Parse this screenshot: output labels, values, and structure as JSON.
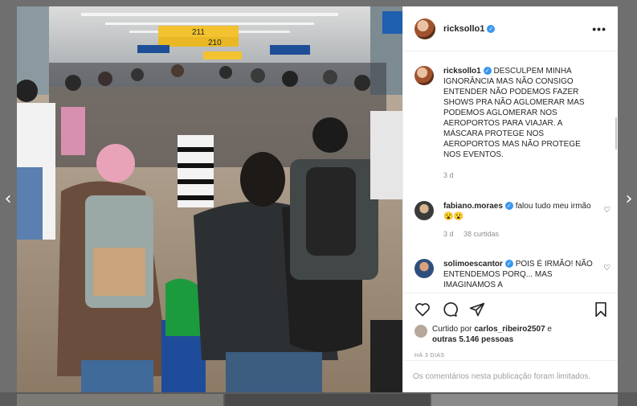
{
  "post": {
    "author": "ricksollo1",
    "more_label": "•••",
    "caption": "DESCULPEM MINHA IGNORÂNCIA MAS NÃO CONSIGO ENTENDER NÃO PODEMOS FAZER SHOWS PRA NÃO AGLOMERAR MAS PODEMOS AGLOMERAR NOS AEROPORTOS PARA VIAJAR. A MÁSCARA PROTEGE NOS AEROPORTOS MAS NÃO PROTEGE NOS EVENTOS.",
    "caption_time": "3 d"
  },
  "photo": {
    "signs": [
      "211",
      "210"
    ]
  },
  "comments": [
    {
      "user": "fabiano.moraes",
      "text": "falou tudo meu irmão 😮😮",
      "time": "3 d",
      "likes": "38 curtidas"
    },
    {
      "user": "solimoescantor",
      "text": "POIS É IRMÃO! NÃO ENTENDEMOS PORQ... MAS IMAGINAMOS A",
      "time": "",
      "likes": ""
    }
  ],
  "likes": {
    "prefix": "Curtido por",
    "user": "carlos_ribeiro2507",
    "mid": "e",
    "others": "outras 5.146 pessoas"
  },
  "timestamp": "HÁ 3 DIAS",
  "comments_limited": "Os comentários nesta publicação foram limitados.",
  "nav": {
    "prev": "‹",
    "next": "›"
  },
  "colors": {
    "verified": "#3897f0",
    "text": "#262626",
    "muted": "#8e8e8e"
  }
}
